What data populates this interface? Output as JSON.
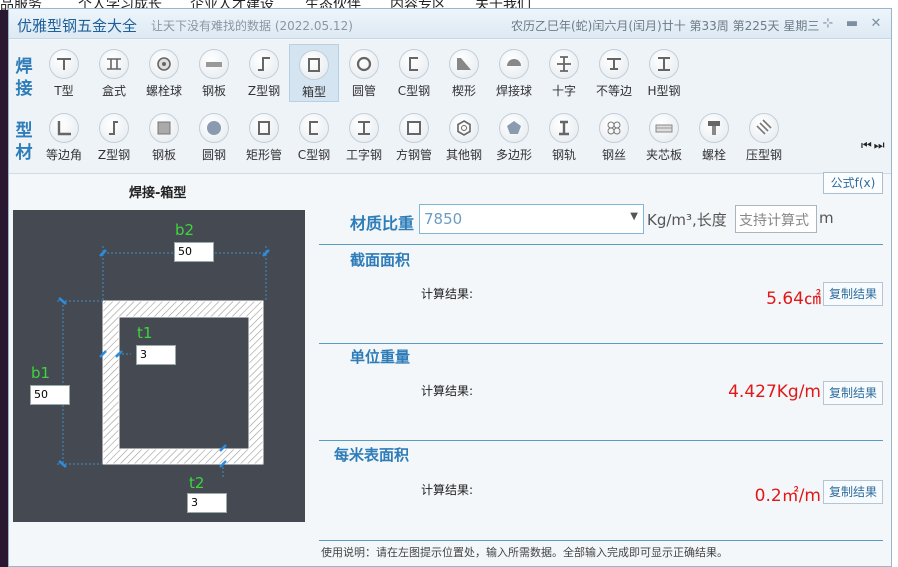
{
  "background_page": {
    "menu_items": [
      "品服务",
      "个人学习成长",
      "企业人才建设",
      "生态伙伴",
      "内容专区",
      "关于我们"
    ]
  },
  "window": {
    "title": "优雅型钢五金大全",
    "slogan": "让天下没有难找的数据 (2022.05.12)",
    "date_info": "农历乙巳年(蛇)闰六月(闰月)廿十 第33周 第225天 星期三",
    "pin_icon": "pin-icon",
    "controls": [
      "minimize-icon",
      "close-icon"
    ]
  },
  "toolbar": {
    "row1_label": [
      "焊",
      "接"
    ],
    "row2_label": [
      "型",
      "材"
    ],
    "row1": [
      {
        "label": "T型",
        "icon": "t-beam-icon"
      },
      {
        "label": "盒式",
        "icon": "box-beam-icon"
      },
      {
        "label": "螺栓球",
        "icon": "bolt-ball-icon"
      },
      {
        "label": "钢板",
        "icon": "steel-plate-icon"
      },
      {
        "label": "Z型钢",
        "icon": "z-steel-icon"
      },
      {
        "label": "箱型",
        "icon": "box-section-icon"
      },
      {
        "label": "圆管",
        "icon": "round-tube-icon"
      },
      {
        "label": "C型钢",
        "icon": "c-steel-icon"
      },
      {
        "label": "楔形",
        "icon": "wedge-icon"
      },
      {
        "label": "焊接球",
        "icon": "weld-ball-icon"
      },
      {
        "label": "十字",
        "icon": "cross-icon"
      },
      {
        "label": "不等边",
        "icon": "unequal-icon"
      },
      {
        "label": "H型钢",
        "icon": "h-beam-icon"
      }
    ],
    "row2": [
      {
        "label": "等边角",
        "icon": "equal-angle-icon"
      },
      {
        "label": "Z型钢",
        "icon": "z-steel-icon"
      },
      {
        "label": "钢板",
        "icon": "steel-plate-icon"
      },
      {
        "label": "圆钢",
        "icon": "round-bar-icon"
      },
      {
        "label": "矩形管",
        "icon": "rect-tube-icon"
      },
      {
        "label": "C型钢",
        "icon": "c-steel-icon"
      },
      {
        "label": "工字钢",
        "icon": "i-beam-icon"
      },
      {
        "label": "方钢管",
        "icon": "square-tube-icon"
      },
      {
        "label": "其他钢",
        "icon": "hex-nut-icon"
      },
      {
        "label": "多边形",
        "icon": "polygon-icon"
      },
      {
        "label": "钢轨",
        "icon": "rail-icon"
      },
      {
        "label": "钢丝",
        "icon": "wire-icon"
      },
      {
        "label": "夹芯板",
        "icon": "sandwich-panel-icon"
      },
      {
        "label": "螺栓",
        "icon": "bolt-icon"
      },
      {
        "label": "压型钢",
        "icon": "profiled-steel-icon"
      }
    ],
    "active_item": "箱型",
    "nav_arrows": "⏮⏭"
  },
  "diagram": {
    "title": "焊接-箱型",
    "b2": {
      "label": "b2",
      "value": "50"
    },
    "t1": {
      "label": "t1",
      "value": "3"
    },
    "b1": {
      "label": "b1",
      "value": "50"
    },
    "t2": {
      "label": "t2",
      "value": "3"
    }
  },
  "formula_button": "公式f(x)",
  "material": {
    "label": "材质比重",
    "value": "7850",
    "unit": "Kg/m³,长度",
    "length_placeholder": "支持计算式",
    "length_unit": "m"
  },
  "sections": [
    {
      "title": "截面面积",
      "calc_label": "计算结果:",
      "result": "5.64㎠",
      "copy": "复制结果"
    },
    {
      "title": "单位重量",
      "calc_label": "计算结果:",
      "result": "4.427Kg/m",
      "copy": "复制结果"
    },
    {
      "title": "每米表面积",
      "calc_label": "计算结果:",
      "result": "0.2㎡/m",
      "copy": "复制结果"
    }
  ],
  "usage": "使用说明：请在左图提示位置处，输入所需数据。全部输入完成即可显示正确结果。",
  "colors": {
    "accent": "#2e7db8",
    "result": "#e01818",
    "dimension": "#3fd43f",
    "diagram_bg": "#454a52"
  }
}
